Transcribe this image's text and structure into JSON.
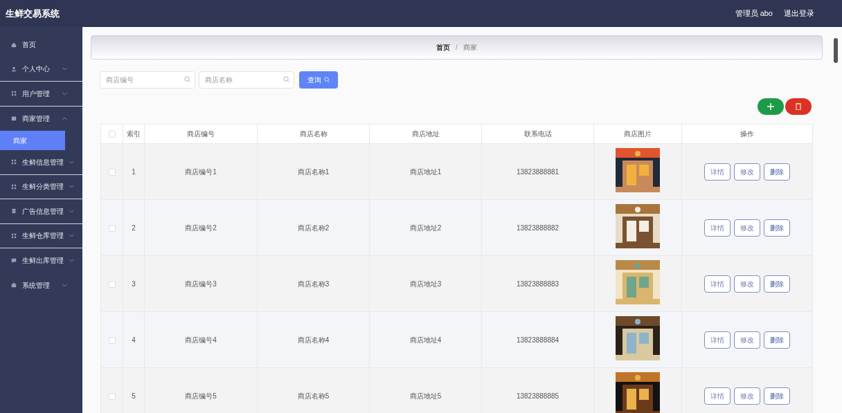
{
  "header": {
    "title": "生鲜交易系统",
    "user": "管理员 abo",
    "logout": "退出登录"
  },
  "sidebar": {
    "items": [
      {
        "label": "首页",
        "selected": false
      },
      {
        "label": "个人中心",
        "selected": false,
        "expanded": false
      },
      {
        "label": "用户管理",
        "selected": false,
        "expanded": false
      },
      {
        "label": "商家管理",
        "selected": false,
        "expanded": true,
        "children": [
          {
            "label": "商家",
            "selected": true
          }
        ]
      },
      {
        "label": "生鲜信息管理",
        "selected": false,
        "expanded": false
      },
      {
        "label": "生鲜分类管理",
        "selected": false,
        "expanded": false
      },
      {
        "label": "广告信息管理",
        "selected": false,
        "expanded": false
      },
      {
        "label": "生鲜仓库管理",
        "selected": false,
        "expanded": false
      },
      {
        "label": "生鲜出库管理",
        "selected": false,
        "expanded": false
      },
      {
        "label": "系统管理",
        "selected": false,
        "expanded": false
      }
    ]
  },
  "breadcrumb": [
    "首页",
    "/",
    "商家"
  ],
  "search": {
    "fields": [
      {
        "placeholder": "商店编号"
      },
      {
        "placeholder": "商店名称"
      }
    ],
    "button": "查询"
  },
  "table": {
    "all_checked": false,
    "columns": [
      "索引",
      "商店编号",
      "商店名称",
      "商店地址",
      "联系电话",
      "商店图片",
      "操作"
    ],
    "rows": [
      {
        "checked": false,
        "index": "1",
        "code": "商店编号1",
        "name": "商店名称1",
        "address": "商店地址1",
        "phone": "13823888881",
        "actions": [
          "详情",
          "修改",
          "删除"
        ]
      },
      {
        "checked": false,
        "index": "2",
        "code": "商店编号2",
        "name": "商店名称2",
        "address": "商店地址2",
        "phone": "13823888882",
        "actions": [
          "详情",
          "修改",
          "删除"
        ]
      },
      {
        "checked": false,
        "index": "3",
        "code": "商店编号3",
        "name": "商店名称3",
        "address": "商店地址3",
        "phone": "13823888883",
        "actions": [
          "详情",
          "修改",
          "删除"
        ]
      },
      {
        "checked": false,
        "index": "4",
        "code": "商店编号4",
        "name": "商店名称4",
        "address": "商店地址4",
        "phone": "13823888884",
        "actions": [
          "详情",
          "修改",
          "删除"
        ]
      },
      {
        "checked": false,
        "index": "5",
        "code": "商店编号5",
        "name": "商店名称5",
        "address": "商店地址5",
        "phone": "13823888885",
        "actions": [
          "详情",
          "修改",
          "删除"
        ]
      }
    ]
  }
}
